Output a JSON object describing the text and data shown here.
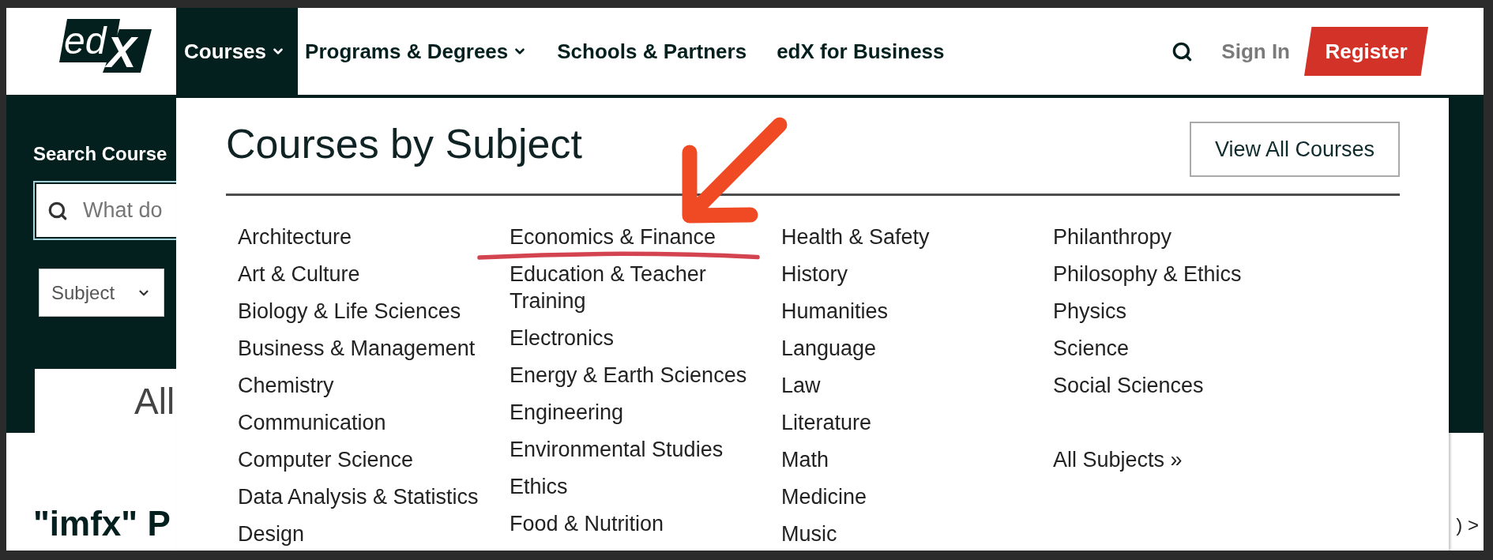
{
  "header": {
    "logo": {
      "text": "ed",
      "mark": "X"
    },
    "nav": [
      {
        "label": "Courses",
        "selected": true,
        "has_dropdown": true
      },
      {
        "label": "Programs & Degrees",
        "selected": false,
        "has_dropdown": true
      },
      {
        "label": "Schools & Partners",
        "selected": false,
        "has_dropdown": false
      },
      {
        "label": "edX for Business",
        "selected": false,
        "has_dropdown": false
      }
    ],
    "sign_in": "Sign In",
    "register": "Register"
  },
  "hero": {
    "search_label": "Search Course",
    "search_field": {
      "placeholder": "What do"
    },
    "subject_select": {
      "value": "Subject"
    },
    "card_title": "All"
  },
  "results": {
    "heading": "\"imfx\" P",
    "pager": ") >"
  },
  "dropdown": {
    "title": "Courses by Subject",
    "view_all_button": "View All Courses",
    "columns": [
      {
        "items": [
          "Architecture",
          "Art & Culture",
          "Biology & Life Sciences",
          "Business & Management",
          "Chemistry",
          "Communication",
          "Computer Science",
          "Data Analysis & Statistics",
          "Design"
        ]
      },
      {
        "items": [
          "Economics & Finance",
          "Education & Teacher Training",
          "Electronics",
          "Energy & Earth Sciences",
          "Engineering",
          "Environmental Studies",
          "Ethics",
          "Food & Nutrition"
        ]
      },
      {
        "items": [
          "Health & Safety",
          "History",
          "Humanities",
          "Language",
          "Law",
          "Literature",
          "Math",
          "Medicine",
          "Music"
        ]
      },
      {
        "items": [
          "Philanthropy",
          "Philosophy & Ethics",
          "Physics",
          "Science",
          "Social Sciences"
        ],
        "more_link": "All Subjects »"
      }
    ]
  }
}
